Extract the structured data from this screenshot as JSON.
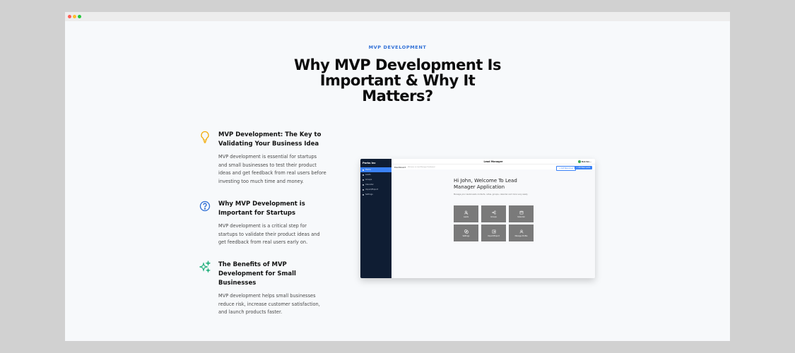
{
  "browser": {
    "dots": [
      "#ff5f56",
      "#ffbd2e",
      "#27c93f"
    ]
  },
  "section": {
    "eyebrow": "MVP DEVELOPMENT",
    "title_lines": [
      "Why MVP Development Is",
      "Important & Why It",
      "Matters?"
    ]
  },
  "features": [
    {
      "icon": "lightbulb-icon",
      "title": "MVP Development: The Key to Validating Your Business Idea",
      "body": "MVP development is essential for startups and small businesses to test their product ideas and get feedback from real users before investing too much time and money."
    },
    {
      "icon": "question-circle-icon",
      "title": "Why MVP Development is Important for Startups",
      "body": "MVP development is a critical step for startups to validate their product ideas and get feedback from real users early on."
    },
    {
      "icon": "sparkles-icon",
      "title": "The Benefits of MVP Development for Small Businesses",
      "body": "MVP development helps small businesses reduce risk, increase customer satisfaction, and launch products faster."
    }
  ],
  "mockup": {
    "brand": "Parks Inc",
    "nav": [
      "Home",
      "Leads",
      "Groups",
      "Calendar",
      "Import/Export",
      "Settings"
    ],
    "app_title": "Lead Manager",
    "user": "Bob Sm...",
    "page_label": "Dashboard",
    "page_hint": "Welcome to Lead Manager Dashboard",
    "btn_outline": "+ Add New Group",
    "btn_primary": "+ Add New Leads",
    "welcome": "Hi John, Welcome To Lead Manager Application",
    "subtitle": "Manage your leads leads contacts, notes, groups, calendar and more very easily",
    "tiles": [
      "Leads",
      "Groups",
      "Calendar",
      "Settings",
      "Import/Export",
      "Manage Profile"
    ]
  }
}
